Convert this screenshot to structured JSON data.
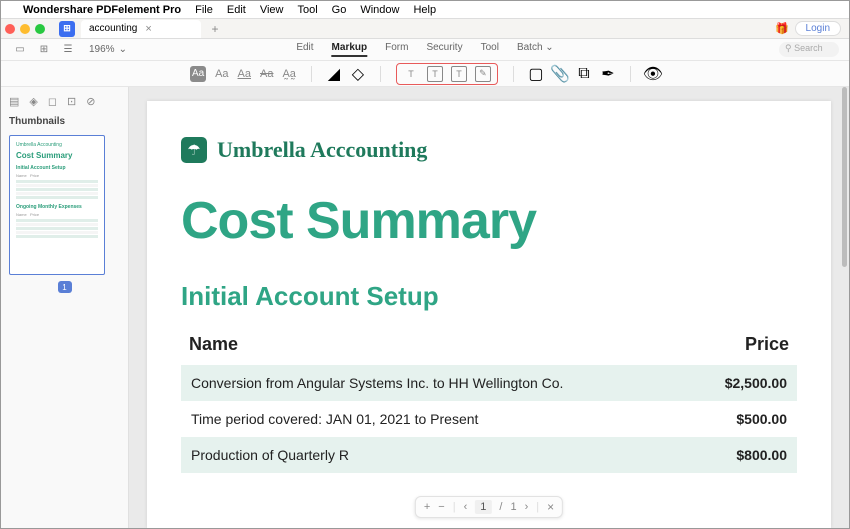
{
  "menubar": {
    "appname": "Wondershare PDFelement Pro",
    "items": [
      "File",
      "Edit",
      "View",
      "Tool",
      "Go",
      "Window",
      "Help"
    ]
  },
  "tabbar": {
    "tabname": "accounting",
    "login": "Login"
  },
  "toolbar": {
    "zoom": "196%",
    "tabs": {
      "edit": "Edit",
      "markup": "Markup",
      "form": "Form",
      "security": "Security",
      "tool": "Tool",
      "batch": "Batch"
    },
    "search_placeholder": "Search"
  },
  "side": {
    "label": "Thumbnails",
    "pagenum": "1"
  },
  "doc": {
    "brand": "Umbrella Acccounting",
    "title": "Cost Summary",
    "section": "Initial Account Setup",
    "col_name": "Name",
    "col_price": "Price",
    "rows": [
      {
        "name": "Conversion from Angular Systems Inc. to HH Wellington Co.",
        "price": "$2,500.00"
      },
      {
        "name": "Time period covered: JAN 01, 2021 to Present",
        "price": "$500.00"
      },
      {
        "name": "Production of Quarterly R",
        "price": "$800.00"
      }
    ]
  },
  "pager": {
    "cur": "1",
    "total": "1"
  },
  "thumb": {
    "brand": "Umbrella Accounting",
    "title": "Cost Summary",
    "sec1": "Initial Account Setup",
    "sec2": "Ongoing Monthly Expenses"
  }
}
